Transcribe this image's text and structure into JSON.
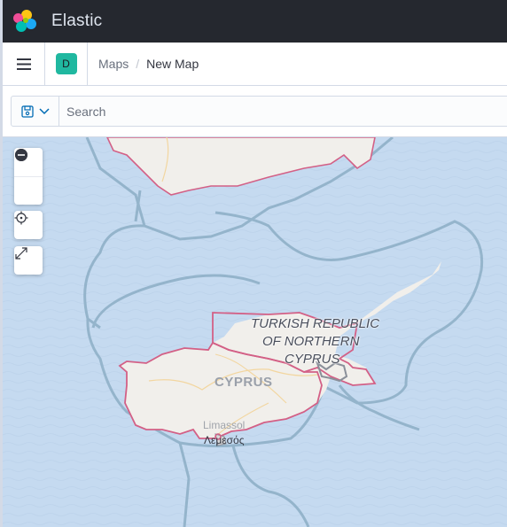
{
  "app": {
    "brand": "Elastic"
  },
  "header": {
    "avatar_initial": "D",
    "breadcrumbs": [
      {
        "label": "Maps"
      },
      {
        "label": "New Map"
      }
    ],
    "separator": "/"
  },
  "query": {
    "placeholder": "Search"
  },
  "map": {
    "controls": [
      "zoom-in",
      "zoom-out",
      "set-view",
      "fit-to-data"
    ],
    "labels": {
      "trnc": [
        "TURKISH REPUBLIC",
        "OF NORTHERN",
        "CYPRUS"
      ],
      "cyprus": "CYPRUS",
      "limassol": "Limassol",
      "limassol_greek": "Λεμεσός"
    },
    "colors": {
      "sea": "#c5daf0",
      "land": "#f1efeb",
      "border": "#d36086",
      "maritime": "#8fb0c8"
    }
  }
}
